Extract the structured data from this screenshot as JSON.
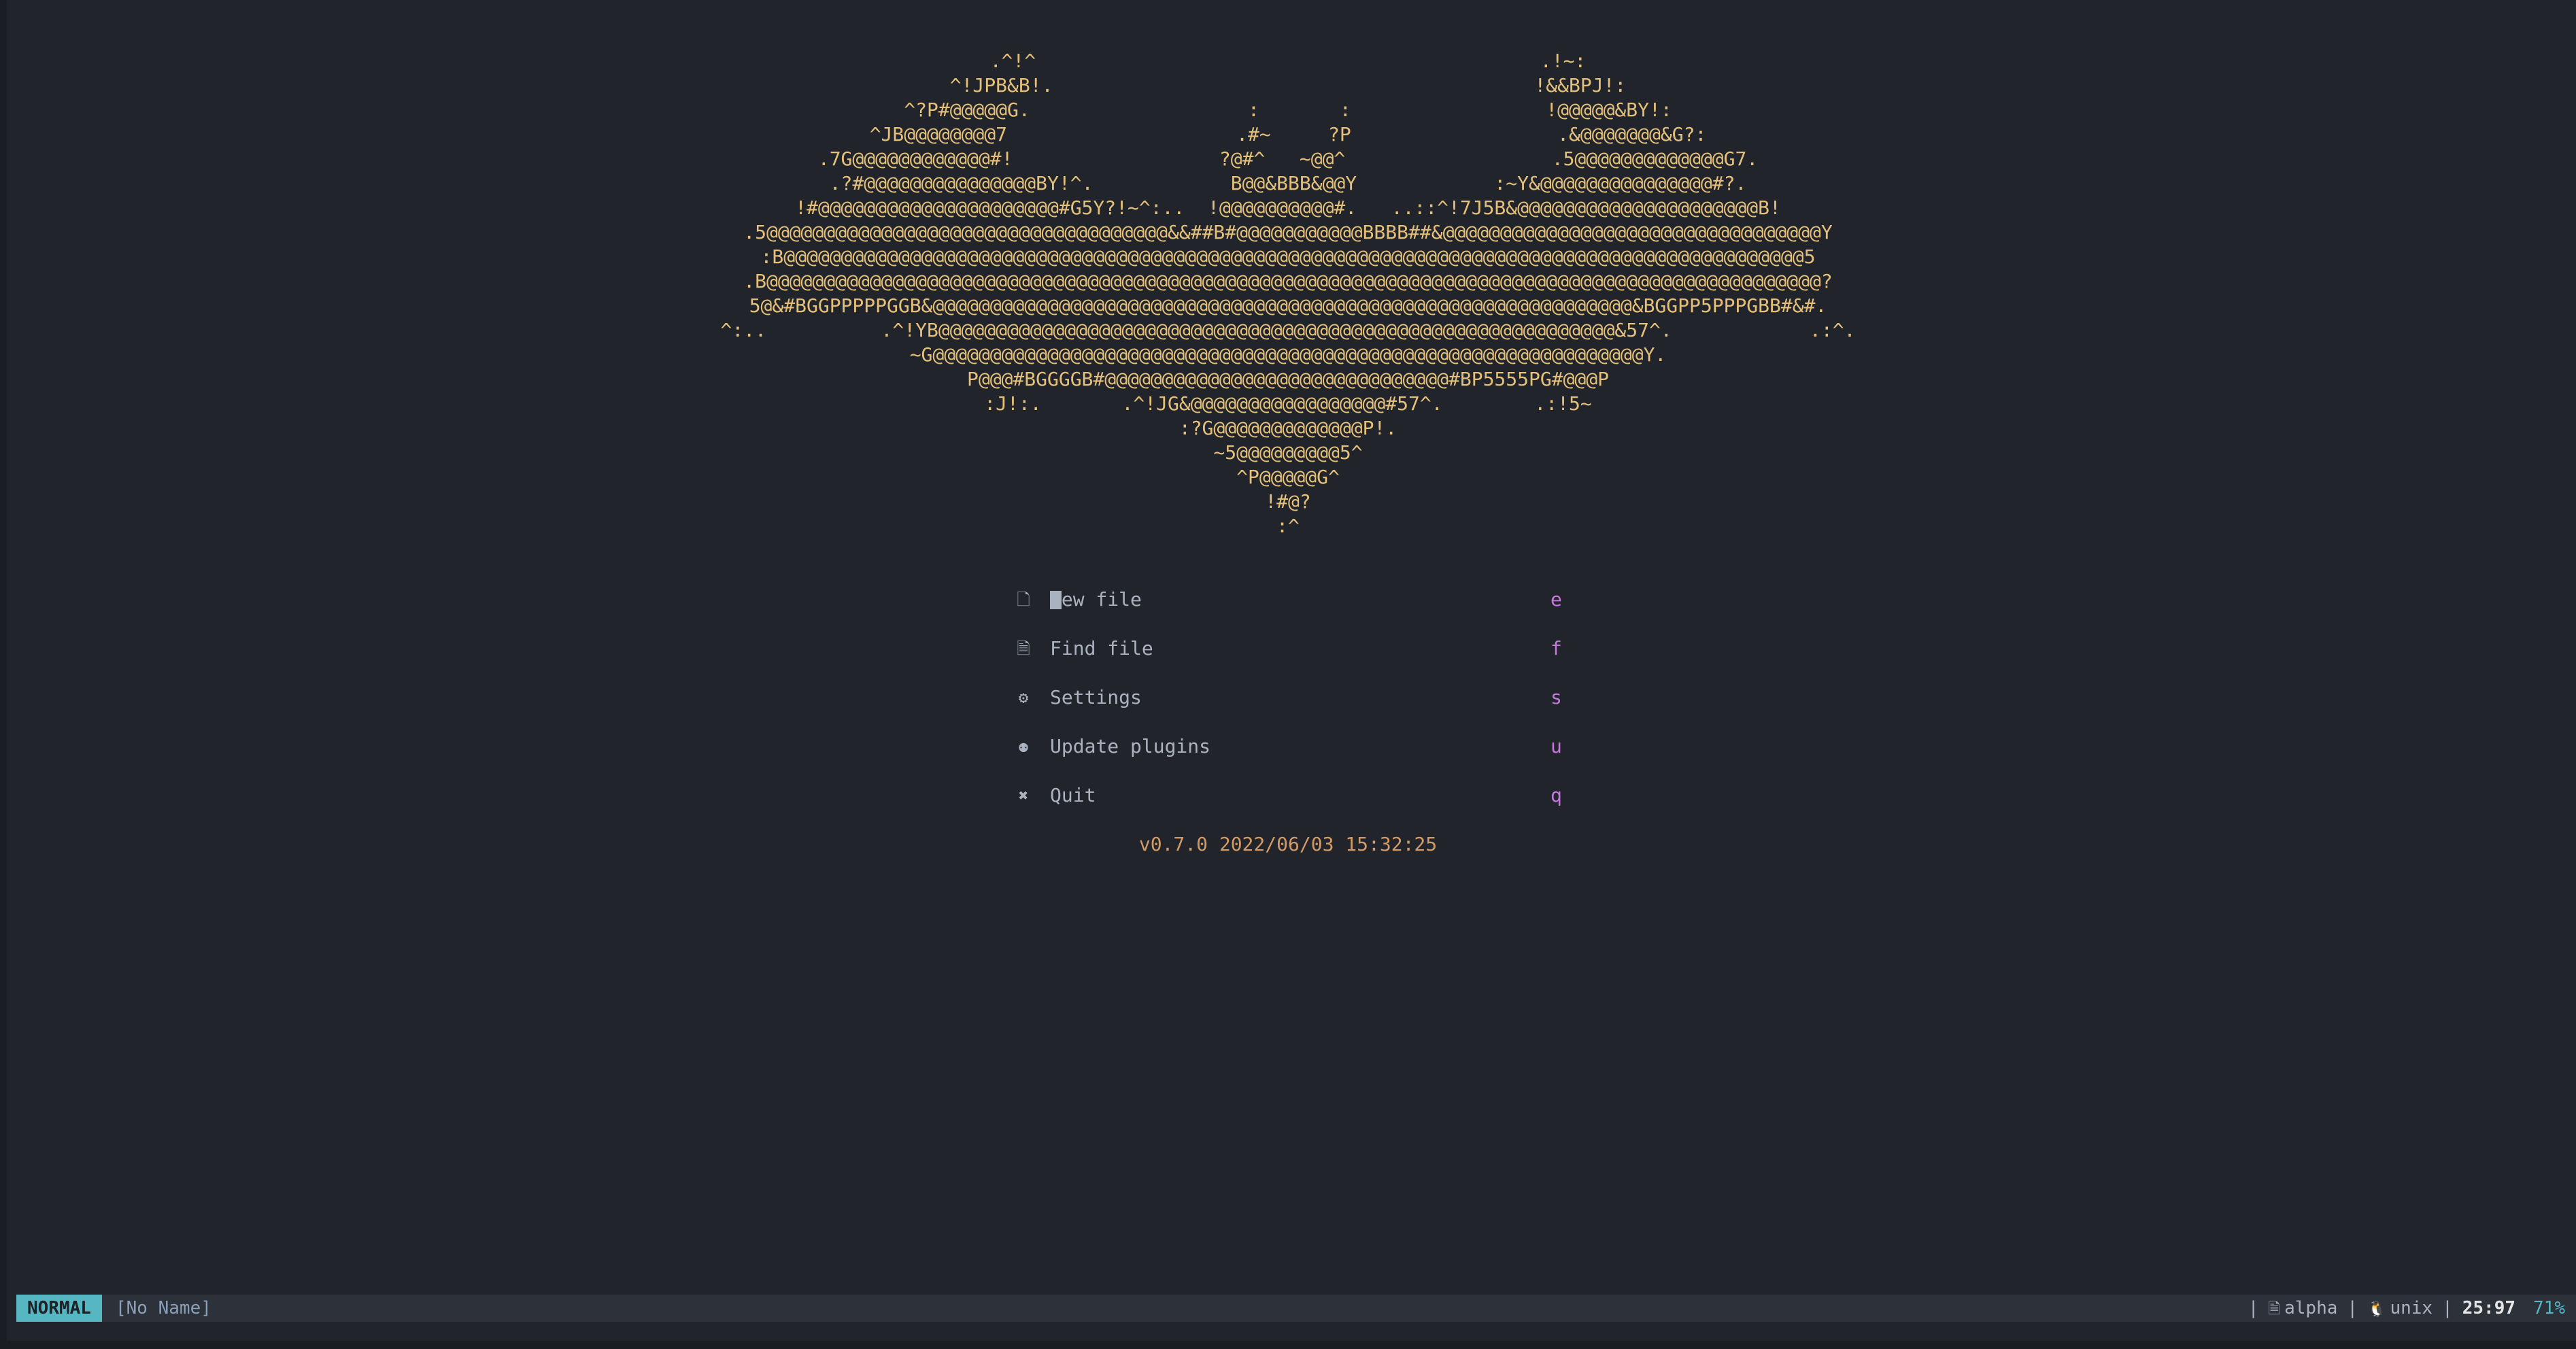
{
  "banner": {
    "lines": [
      "           .^!^                                            .!~:           ",
      "        ^!JPB&B!.                                          !&&BPJ!:        ",
      "      ^?P#@@@@@G.                   :       :                 !@@@@@&BY!:      ",
      "    ^JB@@@@@@@@7                    .#~     ?P                  .&@@@@@@@&G?:    ",
      "  .7G@@@@@@@@@@@@#!                  ?@#^   ~@@^                  .5@@@@@@@@@@@@@G7.  ",
      " .?#@@@@@@@@@@@@@@@BY!^.            B@@&BBB&@@Y            :~Y&@@@@@@@@@@@@@@@#?. ",
      "!#@@@@@@@@@@@@@@@@@@@@@#G5Y?!~^:..  !@@@@@@@@@@#.   ..::^!7J5B&@@@@@@@@@@@@@@@@@@@@@B!",
      ".5@@@@@@@@@@@@@@@@@@@@@@@@@@@@@@@@@@@&&##B#@@@@@@@@@@@BBBB##&@@@@@@@@@@@@@@@@@@@@@@@@@@@@@@@@@Y",
      ":B@@@@@@@@@@@@@@@@@@@@@@@@@@@@@@@@@@@@@@@@@@@@@@@@@@@@@@@@@@@@@@@@@@@@@@@@@@@@@@@@@@@@@@@@@5",
      ".B@@@@@@@@@@@@@@@@@@@@@@@@@@@@@@@@@@@@@@@@@@@@@@@@@@@@@@@@@@@@@@@@@@@@@@@@@@@@@@@@@@@@@@@@@@@@?",
      "5@&#BGGPPPPPGGB&@@@@@@@@@@@@@@@@@@@@@@@@@@@@@@@@@@@@@@@@@@@@@@@@@@@@@@@@@@@@@&BGGPP5PPPGBB#&#.",
      "^:..          .^!YB@@@@@@@@@@@@@@@@@@@@@@@@@@@@@@@@@@@@@@@@@@@@@@@@@@@@@@@@@@@&57^.            .:^.",
      "         ~G@@@@@@@@@@@@@@@@@@@@@@@@@@@@@@@@@@@@@@@@@@@@@@@@@@@@@@@@@@@@@@Y.         ",
      "           P@@@#BGGGGB#@@@@@@@@@@@@@@@@@@@@@@@@@@@@@@#BP5555PG#@@@P           ",
      "           :J!:.       .^!JG&@@@@@@@@@@@@@@@@@#57^.        .:!5~           ",
      "                          :?G@@@@@@@@@@@@@P!.                          ",
      "                             ~5@@@@@@@@@5^                             ",
      "                               ^P@@@@@G^                               ",
      "                                 !#@?                                 ",
      "                                  :^                                  "
    ]
  },
  "menu": {
    "items": [
      {
        "icon": "new-file-icon",
        "label": "New file",
        "shortcut": "e"
      },
      {
        "icon": "find-file-icon",
        "label": "Find file",
        "shortcut": "f"
      },
      {
        "icon": "settings-gear-icon",
        "label": "Settings",
        "shortcut": "s"
      },
      {
        "icon": "github-cat-icon",
        "label": "Update plugins",
        "shortcut": "u"
      },
      {
        "icon": "quit-close-icon",
        "label": "Quit",
        "shortcut": "q"
      }
    ]
  },
  "footer": {
    "version": "v0.7.0 2022/06/03 15:32:25"
  },
  "statusline": {
    "mode": "NORMAL",
    "buffer": "[No Name]",
    "separator": "|",
    "filetype": "alpha",
    "fileformat": "unix",
    "position": "25:97",
    "percent": "71%"
  },
  "colors": {
    "background": "#21252b",
    "banner": "#e5c07b",
    "text": "#abb2bf",
    "shortcut": "#c678dd",
    "version": "#d19a66",
    "mode_badge": "#56b6c2"
  }
}
